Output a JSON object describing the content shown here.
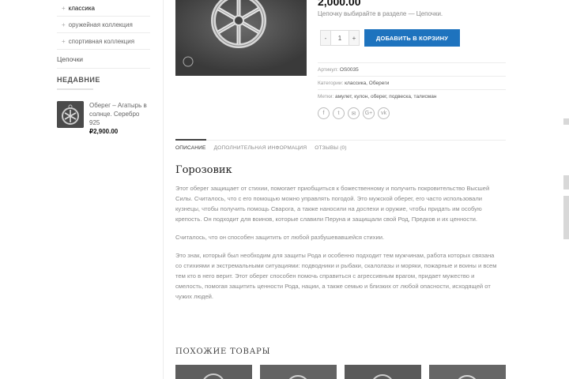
{
  "sidebar": {
    "categories": [
      {
        "label": "классика",
        "active": true
      },
      {
        "label": "оружейная коллекция",
        "active": false
      },
      {
        "label": "спортивная коллекция",
        "active": false
      }
    ],
    "top_category": "Цепочки",
    "recent_heading": "НЕДАВНИЕ",
    "recent_product": {
      "title": "Оберег – Агатырь в солнце. Серебро 925",
      "price": "₽2,900.00"
    }
  },
  "product": {
    "price": "2,000.00",
    "chain_note": "Цепочку выбирайте в разделе — Цепочки.",
    "qty": "1",
    "qty_minus": "-",
    "qty_plus": "+",
    "add_to_cart": "ДОБАВИТЬ В КОРЗИНУ",
    "sku_label": "Артикул:",
    "sku": "OS0035",
    "categories_label": "Категории:",
    "categories": "классика, Обереги",
    "tags_label": "Метки:",
    "tags": "амулет, кулон, оберег, подвеска, талисман",
    "share_icons": [
      "facebook-icon",
      "twitter-icon",
      "email-icon",
      "google-plus-icon",
      "vk-icon"
    ],
    "share_glyphs": [
      "f",
      "t",
      "✉",
      "G+",
      "vk"
    ]
  },
  "tabs": [
    {
      "label": "ОПИСАНИЕ",
      "active": true
    },
    {
      "label": "ДОПОЛНИТЕЛЬНАЯ ИНФОРМАЦИЯ",
      "active": false
    },
    {
      "label": "ОТЗЫВЫ (0)",
      "active": false
    }
  ],
  "description": {
    "title": "Горозовик",
    "p1": "Этот оберег защищает от стихии, помогает приобщиться к божественному и получить покровительство Высшей Силы. Считалось, что с его помощью можно управлять погодой. Это мужской оберег, его часто использовали кузнецы, чтобы получить помощь Сварога, а также наносили на доспехи и оружие, чтобы придать им особую крепость. Он подходит для воинов, которые славили Перуна и защищали свой Род, Предков и их ценности.",
    "p2": "Считалось, что он способен защитить от любой разбушевавшейся стихии.",
    "p3": "Это знак, который был необходим для защиты Рода и особенно подходит тем мужчинам, работа которых связана со стихиями и экстремальными ситуациями: подводники и рыбаки, скалолазы и моряки, пожарные и воины и всем тем кто в него верит. Этот оберег способен помочь справиться с агрессивным врагом, придает мужество и смелость, помогая защитить ценности Рода, нации, а также семью и близких от любой опасности, исходящей от чужих людей."
  },
  "related": {
    "heading": "ПОХОЖИЕ ТОВАРЫ"
  },
  "colors": {
    "accent": "#1e73be",
    "price": "#111111"
  }
}
